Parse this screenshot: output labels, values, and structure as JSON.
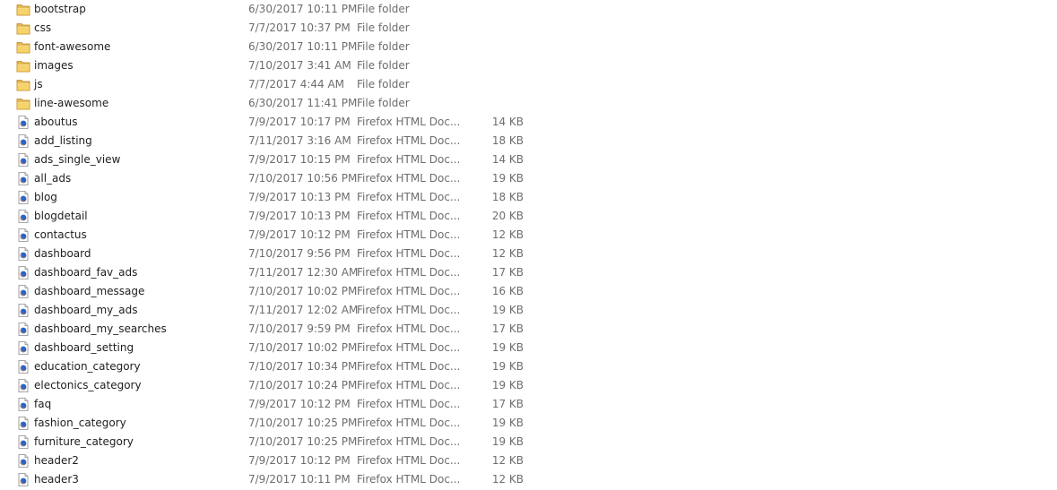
{
  "files": [
    {
      "name": "bootstrap",
      "date": "6/30/2017 10:11 PM",
      "type": "File folder",
      "size": "",
      "icon": "folder-icon"
    },
    {
      "name": "css",
      "date": "7/7/2017 10:37 PM",
      "type": "File folder",
      "size": "",
      "icon": "folder-icon"
    },
    {
      "name": "font-awesome",
      "date": "6/30/2017 10:11 PM",
      "type": "File folder",
      "size": "",
      "icon": "folder-icon"
    },
    {
      "name": "images",
      "date": "7/10/2017 3:41 AM",
      "type": "File folder",
      "size": "",
      "icon": "folder-icon"
    },
    {
      "name": "js",
      "date": "7/7/2017 4:44 AM",
      "type": "File folder",
      "size": "",
      "icon": "folder-icon"
    },
    {
      "name": "line-awesome",
      "date": "6/30/2017 11:41 PM",
      "type": "File folder",
      "size": "",
      "icon": "folder-icon"
    },
    {
      "name": "aboutus",
      "date": "7/9/2017 10:17 PM",
      "type": "Firefox HTML Doc...",
      "size": "14 KB",
      "icon": "firefox-html-document-icon"
    },
    {
      "name": "add_listing",
      "date": "7/11/2017 3:16 AM",
      "type": "Firefox HTML Doc...",
      "size": "18 KB",
      "icon": "firefox-html-document-icon"
    },
    {
      "name": "ads_single_view",
      "date": "7/9/2017 10:15 PM",
      "type": "Firefox HTML Doc...",
      "size": "14 KB",
      "icon": "firefox-html-document-icon"
    },
    {
      "name": "all_ads",
      "date": "7/10/2017 10:56 PM",
      "type": "Firefox HTML Doc...",
      "size": "19 KB",
      "icon": "firefox-html-document-icon"
    },
    {
      "name": "blog",
      "date": "7/9/2017 10:13 PM",
      "type": "Firefox HTML Doc...",
      "size": "18 KB",
      "icon": "firefox-html-document-icon"
    },
    {
      "name": "blogdetail",
      "date": "7/9/2017 10:13 PM",
      "type": "Firefox HTML Doc...",
      "size": "20 KB",
      "icon": "firefox-html-document-icon"
    },
    {
      "name": "contactus",
      "date": "7/9/2017 10:12 PM",
      "type": "Firefox HTML Doc...",
      "size": "12 KB",
      "icon": "firefox-html-document-icon"
    },
    {
      "name": "dashboard",
      "date": "7/10/2017 9:56 PM",
      "type": "Firefox HTML Doc...",
      "size": "12 KB",
      "icon": "firefox-html-document-icon"
    },
    {
      "name": "dashboard_fav_ads",
      "date": "7/11/2017 12:30 AM",
      "type": "Firefox HTML Doc...",
      "size": "17 KB",
      "icon": "firefox-html-document-icon"
    },
    {
      "name": "dashboard_message",
      "date": "7/10/2017 10:02 PM",
      "type": "Firefox HTML Doc...",
      "size": "16 KB",
      "icon": "firefox-html-document-icon"
    },
    {
      "name": "dashboard_my_ads",
      "date": "7/11/2017 12:02 AM",
      "type": "Firefox HTML Doc...",
      "size": "19 KB",
      "icon": "firefox-html-document-icon"
    },
    {
      "name": "dashboard_my_searches",
      "date": "7/10/2017 9:59 PM",
      "type": "Firefox HTML Doc...",
      "size": "17 KB",
      "icon": "firefox-html-document-icon"
    },
    {
      "name": "dashboard_setting",
      "date": "7/10/2017 10:02 PM",
      "type": "Firefox HTML Doc...",
      "size": "19 KB",
      "icon": "firefox-html-document-icon"
    },
    {
      "name": "education_category",
      "date": "7/10/2017 10:34 PM",
      "type": "Firefox HTML Doc...",
      "size": "19 KB",
      "icon": "firefox-html-document-icon"
    },
    {
      "name": "electonics_category",
      "date": "7/10/2017 10:24 PM",
      "type": "Firefox HTML Doc...",
      "size": "19 KB",
      "icon": "firefox-html-document-icon"
    },
    {
      "name": "faq",
      "date": "7/9/2017 10:12 PM",
      "type": "Firefox HTML Doc...",
      "size": "17 KB",
      "icon": "firefox-html-document-icon"
    },
    {
      "name": "fashion_category",
      "date": "7/10/2017 10:25 PM",
      "type": "Firefox HTML Doc...",
      "size": "19 KB",
      "icon": "firefox-html-document-icon"
    },
    {
      "name": "furniture_category",
      "date": "7/10/2017 10:25 PM",
      "type": "Firefox HTML Doc...",
      "size": "19 KB",
      "icon": "firefox-html-document-icon"
    },
    {
      "name": "header2",
      "date": "7/9/2017 10:12 PM",
      "type": "Firefox HTML Doc...",
      "size": "12 KB",
      "icon": "firefox-html-document-icon"
    },
    {
      "name": "header3",
      "date": "7/9/2017 10:11 PM",
      "type": "Firefox HTML Doc...",
      "size": "12 KB",
      "icon": "firefox-html-document-icon"
    }
  ]
}
